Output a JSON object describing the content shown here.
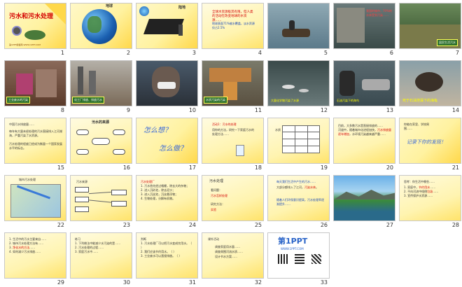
{
  "slides": [
    {
      "num": "1",
      "title": "污水和污水处理",
      "footer": "第1PPT模板网-WWW.1PPT.COM"
    },
    {
      "num": "2",
      "label": "地球"
    },
    {
      "num": "3",
      "label": "陆地"
    },
    {
      "num": "4",
      "text": "全球水资源极其有限，但人类的活动在改变地球的水资源……"
    },
    {
      "num": "5"
    },
    {
      "num": "6",
      "text": "我国的城市，70%的水体受到污染……"
    },
    {
      "num": "7",
      "caption": "居民生活污水"
    },
    {
      "num": "8",
      "caption": "工业废水的污染"
    },
    {
      "num": "9",
      "caption": "化工厂排放、排放污水"
    },
    {
      "num": "10",
      "caption": "农业污水的污染"
    },
    {
      "num": "11",
      "caption": "水质污染的污染"
    },
    {
      "num": "12",
      "caption": "大量化学物污染了水源"
    },
    {
      "num": "13",
      "caption": "石油污染下的海鸟"
    },
    {
      "num": "14",
      "caption": "死于石油泄漏下的海龟"
    },
    {
      "num": "15",
      "text": "中国污水排放量……"
    },
    {
      "num": "16",
      "title": "污水的来源"
    },
    {
      "num": "17",
      "q1": "怎么想？",
      "q2": "怎么做？"
    },
    {
      "num": "18",
      "text": "用你的方法，研究一下家庭污水的处理方法……"
    },
    {
      "num": "19",
      "title": "水质"
    },
    {
      "num": "20",
      "text": "目前，大多数污水是直接排放的……"
    },
    {
      "num": "21",
      "text": "记录下你的发现！"
    },
    {
      "num": "22",
      "title": "城市污水处理"
    },
    {
      "num": "23",
      "title": "污水来源"
    },
    {
      "num": "24",
      "text": "污水处理厂"
    },
    {
      "num": "25",
      "title": "污水处理"
    },
    {
      "num": "26",
      "text": "每天我们生活中产生的污水……"
    },
    {
      "num": "27"
    },
    {
      "num": "28",
      "text": "思考：你生活中哪些……"
    },
    {
      "num": "29"
    },
    {
      "num": "30"
    },
    {
      "num": "31"
    },
    {
      "num": "32",
      "title": "课外活动"
    },
    {
      "num": "33",
      "brand": "第1PPT",
      "url": "WWW.1PPT.COM"
    }
  ]
}
